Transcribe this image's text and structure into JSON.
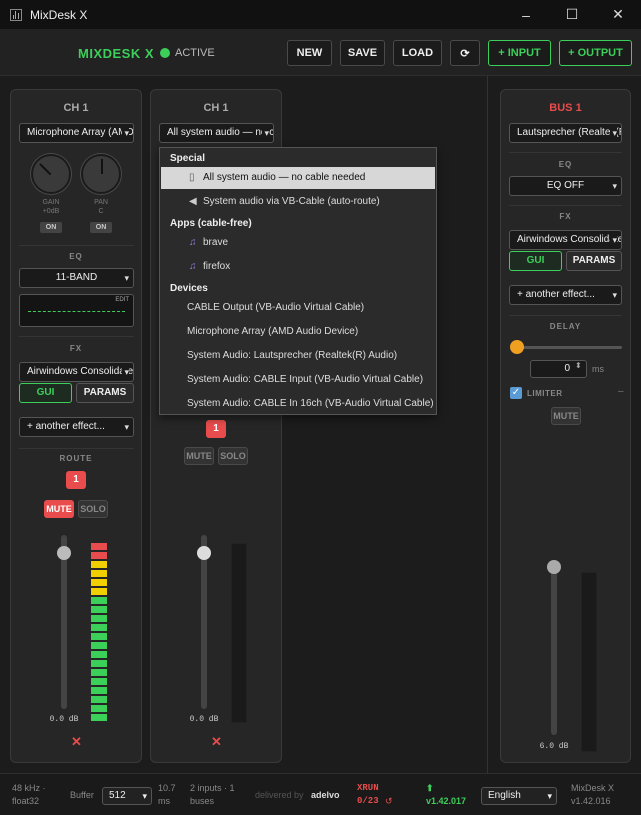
{
  "window": {
    "title": "MixDesk X",
    "minimize": "–",
    "maximize": "☐",
    "close": "✕"
  },
  "header": {
    "brand": "MIXDESK X",
    "status": "ACTIVE",
    "buttons": {
      "new": "NEW",
      "save": "SAVE",
      "load": "LOAD",
      "refresh": "⟳",
      "add_input": "+ INPUT",
      "add_output": "+ OUTPUT"
    }
  },
  "ch1": {
    "title": "CH 1",
    "device": "Microphone Array (AMD Audio Device)",
    "gain_label": "GAIN",
    "gain_value": "+0dB",
    "pan_label": "PAN",
    "pan_value": "C",
    "gain_on": "ON",
    "pan_on": "ON",
    "eq_label": "EQ",
    "eq_mode": "11-BAND",
    "eq_edit": "EDIT",
    "fx_label": "FX",
    "fx_plugin": "Airwindows Consolidated",
    "gui": "GUI",
    "params": "PARAMS",
    "add_effect": "+ another effect...",
    "route_label": "ROUTE",
    "route_badge": "1",
    "mute": "MUTE",
    "solo": "SOLO",
    "fader_value": "0.0 dB",
    "remove": "✕"
  },
  "ch2": {
    "title": "CH 1",
    "device": "All system audio — no cable needed",
    "route_badge": "1",
    "mute": "MUTE",
    "solo": "SOLO",
    "fader_value": "0.0 dB",
    "remove": "✕"
  },
  "menu": {
    "groups": {
      "special": "Special",
      "apps": "Apps (cable-free)",
      "devices": "Devices"
    },
    "items": [
      "All system audio — no cable needed",
      "System audio via VB-Cable (auto-route)",
      "brave",
      "firefox",
      "CABLE Output (VB-Audio Virtual Cable)",
      "Microphone Array (AMD Audio Device)",
      "System Audio: Lautsprecher (Realtek(R) Audio)",
      "System Audio: CABLE Input (VB-Audio Virtual Cable)",
      "System Audio: CABLE In 16ch (VB-Audio Virtual Cable)"
    ]
  },
  "bus1": {
    "title": "BUS 1",
    "device": "Lautsprecher (Realtek(R) Audio)",
    "eq_label": "EQ",
    "eq_mode": "EQ OFF",
    "fx_label": "FX",
    "fx_plugin": "Airwindows Consolidated",
    "gui": "GUI",
    "params": "PARAMS",
    "add_effect": "+ another effect...",
    "delay_label": "DELAY",
    "delay_value": "0",
    "delay_unit": "ms",
    "limiter": "LIMITER",
    "limiter_dash": "–",
    "mute": "MUTE",
    "fader_value": "6.0 dB"
  },
  "footer": {
    "rate": "48 kHz ·",
    "format": "float32",
    "buffer_label": "Buffer",
    "buffer_value": "512",
    "latency_1": "10.7",
    "latency_2": "ms",
    "io_1": "2 inputs · 1",
    "io_2": "buses",
    "delivered": "delivered by",
    "delivered_brand": "adelvo",
    "xrun_label": "XRUN",
    "xrun_value": "0/23",
    "update_icon": "⬆",
    "update_version": "v1.42.017",
    "language": "English",
    "app_name": "MixDesk X",
    "app_version": "v1.42.016"
  },
  "colors": {
    "accent": "#3ccf5a",
    "danger": "#e84c4c",
    "orange": "#f0a020"
  }
}
